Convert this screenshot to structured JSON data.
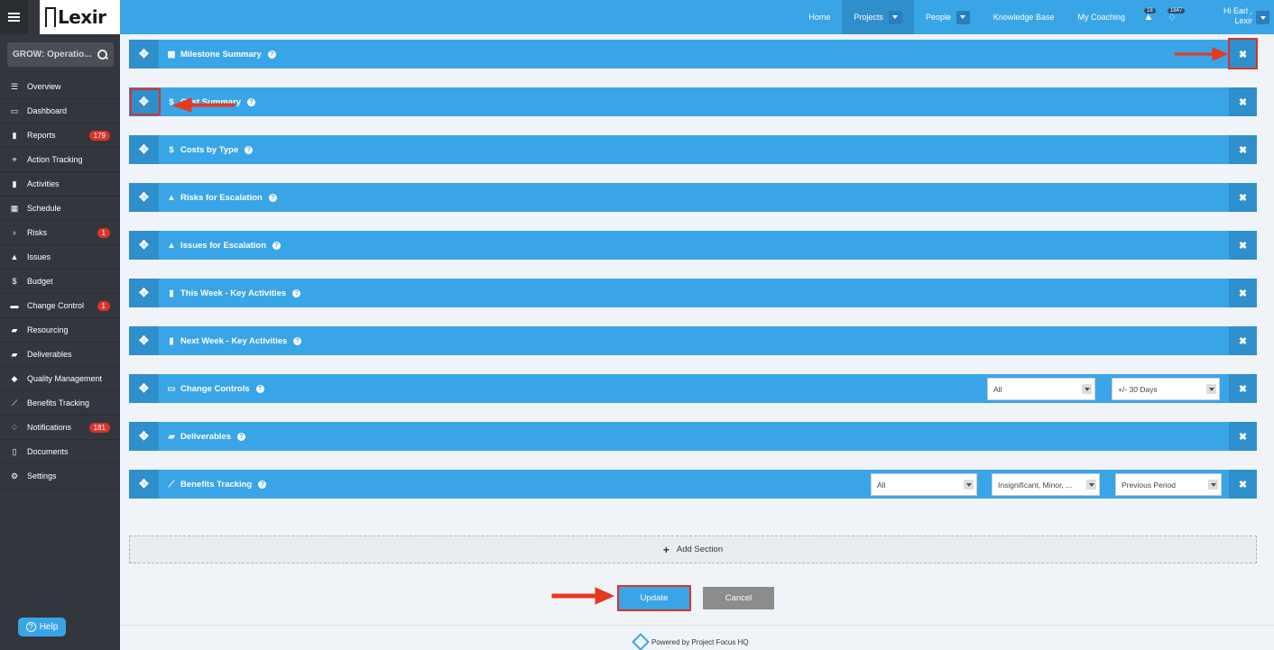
{
  "app": {
    "logo": "Lexir",
    "search_value": "GROW: Operatio..."
  },
  "sidebar": {
    "items": [
      {
        "label": "Overview",
        "icon": "list-icon"
      },
      {
        "label": "Dashboard",
        "icon": "dashboard-icon"
      },
      {
        "label": "Reports",
        "icon": "bar-chart-icon",
        "badge": "179"
      },
      {
        "label": "Action Tracking",
        "icon": "crosshair-icon"
      },
      {
        "label": "Activities",
        "icon": "bookmark-icon"
      },
      {
        "label": "Schedule",
        "icon": "calendar-icon"
      },
      {
        "label": "Risks",
        "icon": "lightbulb-icon",
        "badge": "1"
      },
      {
        "label": "Issues",
        "icon": "warning-icon"
      },
      {
        "label": "Budget",
        "icon": "dollar-icon"
      },
      {
        "label": "Change Control",
        "icon": "tablet-icon",
        "badge": "1"
      },
      {
        "label": "Resourcing",
        "icon": "folder-icon"
      },
      {
        "label": "Deliverables",
        "icon": "truck-icon"
      },
      {
        "label": "Quality Management",
        "icon": "tag-icon"
      },
      {
        "label": "Benefits Tracking",
        "icon": "line-chart-icon"
      },
      {
        "label": "Notifications",
        "icon": "bell-icon",
        "badge": "181"
      },
      {
        "label": "Documents",
        "icon": "file-icon"
      },
      {
        "label": "Settings",
        "icon": "gears-icon"
      }
    ],
    "help": "Help"
  },
  "topnav": {
    "home": "Home",
    "projects": "Projects",
    "people": "People",
    "knowledge_base": "Knowledge Base",
    "my_coaching": "My Coaching",
    "alerts_count": "18",
    "messages_count": "1847",
    "greeting": "Hi Earl ,",
    "org": "Lexir"
  },
  "sections": [
    {
      "title": "Milestone Summary",
      "icon": "calendar-icon"
    },
    {
      "title": "Cost Summary",
      "icon": "dollar-icon"
    },
    {
      "title": "Costs by Type",
      "icon": "dollar-icon"
    },
    {
      "title": "Risks for Escalation",
      "icon": "warning-icon"
    },
    {
      "title": "Issues for Escalation",
      "icon": "warning-icon"
    },
    {
      "title": "This Week - Key Activities",
      "icon": "bookmark-icon"
    },
    {
      "title": "Next Week - Key Activities",
      "icon": "bookmark-icon"
    },
    {
      "title": "Change Controls",
      "icon": "folder-icon",
      "filters": [
        "All",
        "+/- 30 Days"
      ]
    },
    {
      "title": "Deliverables",
      "icon": "truck-icon"
    },
    {
      "title": "Benefits Tracking",
      "icon": "line-chart-icon",
      "filters": [
        "All",
        "Insignificant, Minor, ...",
        "Previous Period"
      ]
    }
  ],
  "actions": {
    "add_section": "Add Section",
    "update": "Update",
    "cancel": "Cancel"
  },
  "footer": {
    "text": "Powered by Project Focus HQ"
  },
  "colors": {
    "accent": "#3aa5e6",
    "accent_dark": "#2f8fcc",
    "sidebar": "#33373d",
    "badge": "#d9332a",
    "highlight": "#d9332a"
  }
}
